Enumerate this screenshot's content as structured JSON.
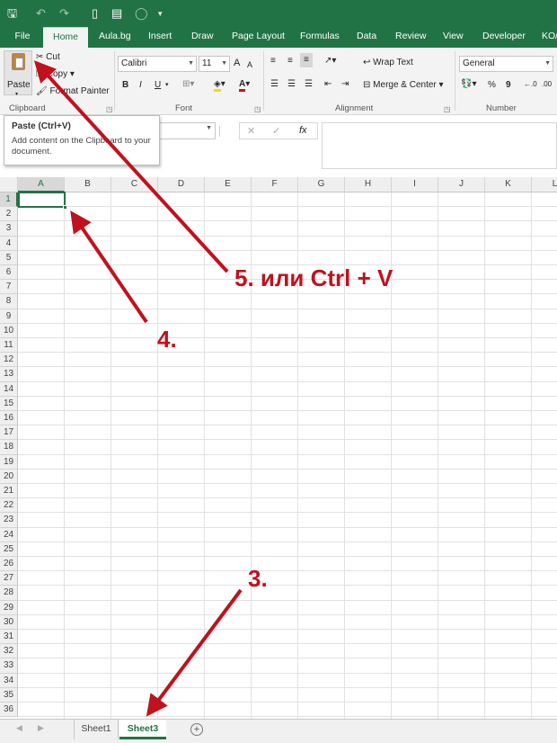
{
  "quick_access": {
    "save": "🖫",
    "undo": "↶",
    "redo": "↷",
    "more": "▾"
  },
  "tabs": [
    "File",
    "Home",
    "Aula.bg",
    "Insert",
    "Draw",
    "Page Layout",
    "Formulas",
    "Data",
    "Review",
    "View",
    "Developer",
    "KO/"
  ],
  "clipboard": {
    "paste": "Paste",
    "cut": "Cut",
    "copy": "Copy",
    "format_painter": "Format Painter",
    "group": "Clipboard"
  },
  "font": {
    "name": "Calibri",
    "size": "11",
    "bold": "B",
    "italic": "I",
    "underline": "U",
    "grow": "A",
    "shrink": "A",
    "group": "Font"
  },
  "alignment": {
    "wrap": "Wrap Text",
    "merge": "Merge & Center",
    "group": "Alignment"
  },
  "number": {
    "format": "General",
    "percent": "%",
    "comma": "9",
    "group": "Number"
  },
  "formula": {
    "cancel": "✕",
    "enter": "✓",
    "fx": "fx"
  },
  "tooltip": {
    "title": "Paste (Ctrl+V)",
    "desc": "Add content on the Clipboard to your document."
  },
  "columns": [
    "A",
    "B",
    "C",
    "D",
    "E",
    "F",
    "G",
    "H",
    "I",
    "J",
    "K",
    "L"
  ],
  "rows": [
    "1",
    "2",
    "3",
    "4",
    "5",
    "6",
    "7",
    "8",
    "9",
    "10",
    "11",
    "12",
    "13",
    "14",
    "15",
    "16",
    "17",
    "18",
    "19",
    "20",
    "21",
    "22",
    "23",
    "24",
    "25",
    "26",
    "27",
    "28",
    "29",
    "30",
    "31",
    "32",
    "33",
    "34",
    "35",
    "36"
  ],
  "sheet_tabs": {
    "sheet1": "Sheet1",
    "sheet3": "Sheet3",
    "add": "+"
  },
  "annotations": {
    "step5": "5.  или Ctrl + V",
    "step4": "4.",
    "step3": "3."
  },
  "colors": {
    "excel_green": "#217346",
    "annotation_red": "#c0121d"
  }
}
